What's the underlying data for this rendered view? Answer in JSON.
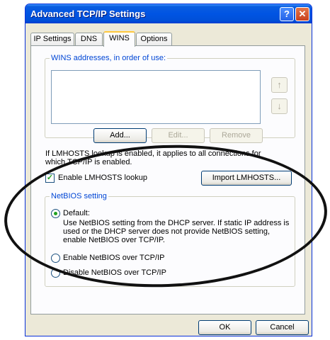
{
  "window": {
    "title": "Advanced TCP/IP Settings",
    "help_glyph": "?",
    "close_glyph": "✕"
  },
  "tabs": [
    "IP Settings",
    "DNS",
    "WINS",
    "Options"
  ],
  "active_tab": "WINS",
  "wins_group": {
    "legend": "WINS addresses, in order of use:",
    "up_arrow": "↑",
    "down_arrow": "↓",
    "add_label": "Add...",
    "edit_label": "Edit...",
    "remove_label": "Remove"
  },
  "lmhosts": {
    "info_text": "If LMHOSTS lookup is enabled, it applies to all connections for which TCP/IP is enabled.",
    "checkbox_label": "Enable LMHOSTS lookup",
    "checked": true,
    "import_label": "Import LMHOSTS..."
  },
  "netbios_group": {
    "legend": "NetBIOS setting",
    "default_label": "Default:",
    "default_description": "Use NetBIOS setting from the DHCP server. If static IP address is used or the DHCP server does not provide NetBIOS setting, enable NetBIOS over TCP/IP.",
    "enable_label": "Enable NetBIOS over TCP/IP",
    "disable_label": "Disable NetBIOS over TCP/IP",
    "selected": "default"
  },
  "footer": {
    "ok_label": "OK",
    "cancel_label": "Cancel"
  },
  "colors": {
    "title_bar": "#0054e3",
    "group_legend": "#0046d5",
    "check_mark": "#21a121"
  }
}
